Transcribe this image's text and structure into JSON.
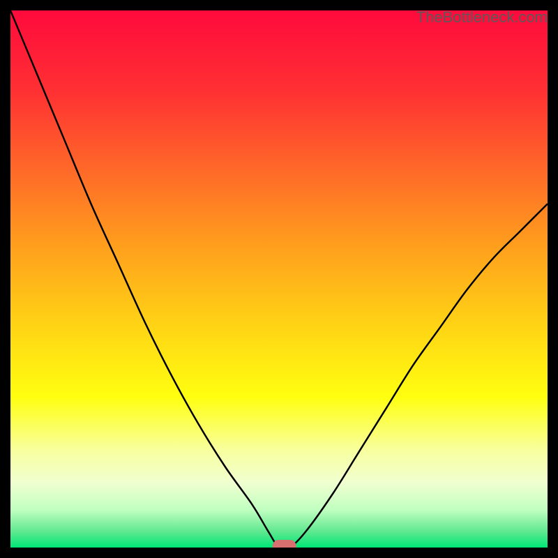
{
  "watermark": "TheBottleneck.com",
  "chart_data": {
    "type": "line",
    "title": "",
    "xlabel": "",
    "ylabel": "",
    "x": [
      0.0,
      0.05,
      0.1,
      0.15,
      0.2,
      0.25,
      0.3,
      0.35,
      0.4,
      0.45,
      0.48,
      0.5,
      0.52,
      0.55,
      0.6,
      0.65,
      0.7,
      0.75,
      0.8,
      0.85,
      0.9,
      0.95,
      1.0
    ],
    "values": [
      100,
      88,
      76,
      64,
      53,
      42,
      32,
      23,
      15,
      8,
      3,
      0,
      0,
      3,
      10,
      18,
      26,
      34,
      41,
      48,
      54,
      59,
      64
    ],
    "xlim": [
      0,
      1
    ],
    "ylim": [
      0,
      100
    ],
    "marker": {
      "x": 0.51,
      "y": 0,
      "color": "#d87070"
    },
    "background_gradient": {
      "stops": [
        {
          "offset": 0.0,
          "color": "#ff0a3c"
        },
        {
          "offset": 0.15,
          "color": "#ff3033"
        },
        {
          "offset": 0.3,
          "color": "#ff6a28"
        },
        {
          "offset": 0.45,
          "color": "#ffa31c"
        },
        {
          "offset": 0.6,
          "color": "#ffd814"
        },
        {
          "offset": 0.72,
          "color": "#ffff10"
        },
        {
          "offset": 0.82,
          "color": "#f8ffa0"
        },
        {
          "offset": 0.88,
          "color": "#f0ffd0"
        },
        {
          "offset": 0.93,
          "color": "#c0ffc0"
        },
        {
          "offset": 0.97,
          "color": "#60e890"
        },
        {
          "offset": 1.0,
          "color": "#00e676"
        }
      ]
    }
  }
}
